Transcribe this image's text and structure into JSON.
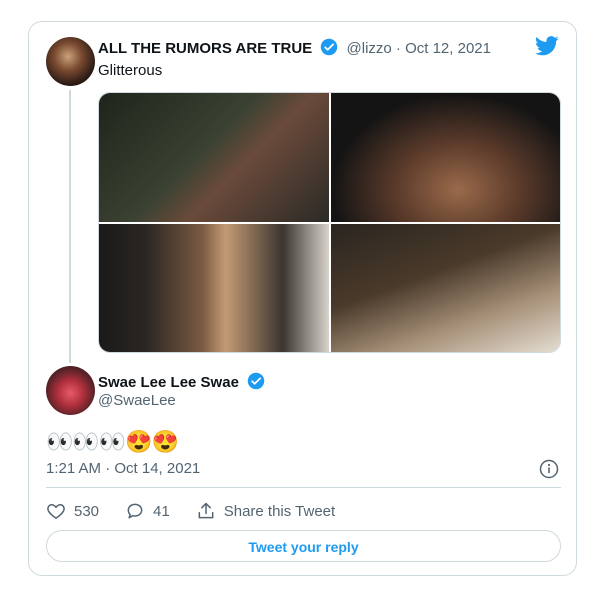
{
  "tweet": {
    "author_name": "ALL THE RUMORS ARE TRUE",
    "meta": "@lizzo · Oct 12, 2021",
    "text": "Glitterous",
    "icons": {
      "brand": "twitter-bird-icon",
      "verified": "verified-badge-icon"
    },
    "colors": {
      "brand": "#1d9bf0",
      "secondary_text": "#536471",
      "border": "#cfd9de"
    },
    "photos_count": 4
  },
  "reply": {
    "author_name": "Swae Lee Lee Swae",
    "handle": "@SwaeLee",
    "text": "👀👀👀😍😍",
    "timestamp": "1:21 AM · Oct 14, 2021",
    "likes": "530",
    "replies": "41",
    "share_label": "Share this Tweet",
    "reply_button_label": "Tweet your reply"
  }
}
